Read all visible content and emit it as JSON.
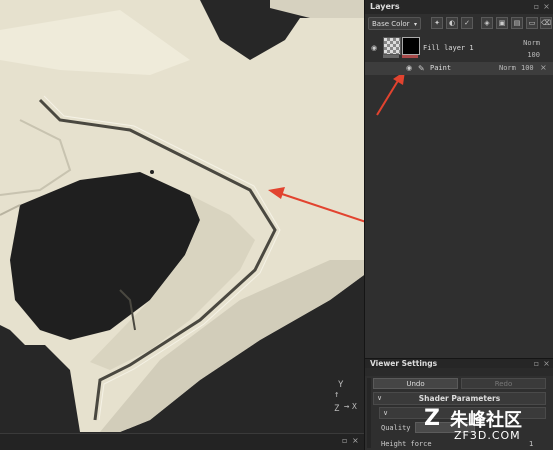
{
  "layers_panel": {
    "title": "Layers",
    "channel_dropdown": "Base Color",
    "fill_layer": {
      "name": "Fill layer 1",
      "blend_mode": "Norm",
      "opacity": "100"
    },
    "paint_layer": {
      "name": "Paint",
      "blend_mode": "Norm",
      "opacity": "100"
    }
  },
  "viewer_settings": {
    "title": "Viewer Settings",
    "undo_label": "Undo",
    "redo_label": "Redo",
    "shader_section": "Shader Parameters",
    "quality_label": "Quality",
    "height_force_label": "Height force",
    "height_force_value": "1"
  },
  "watermark": {
    "chinese": "朱峰社区",
    "url": "ZF3D.COM"
  },
  "colors": {
    "model_surface": "#e4dfcc",
    "arrow": "#e2432f",
    "panel_bg": "#2f2f2f"
  }
}
